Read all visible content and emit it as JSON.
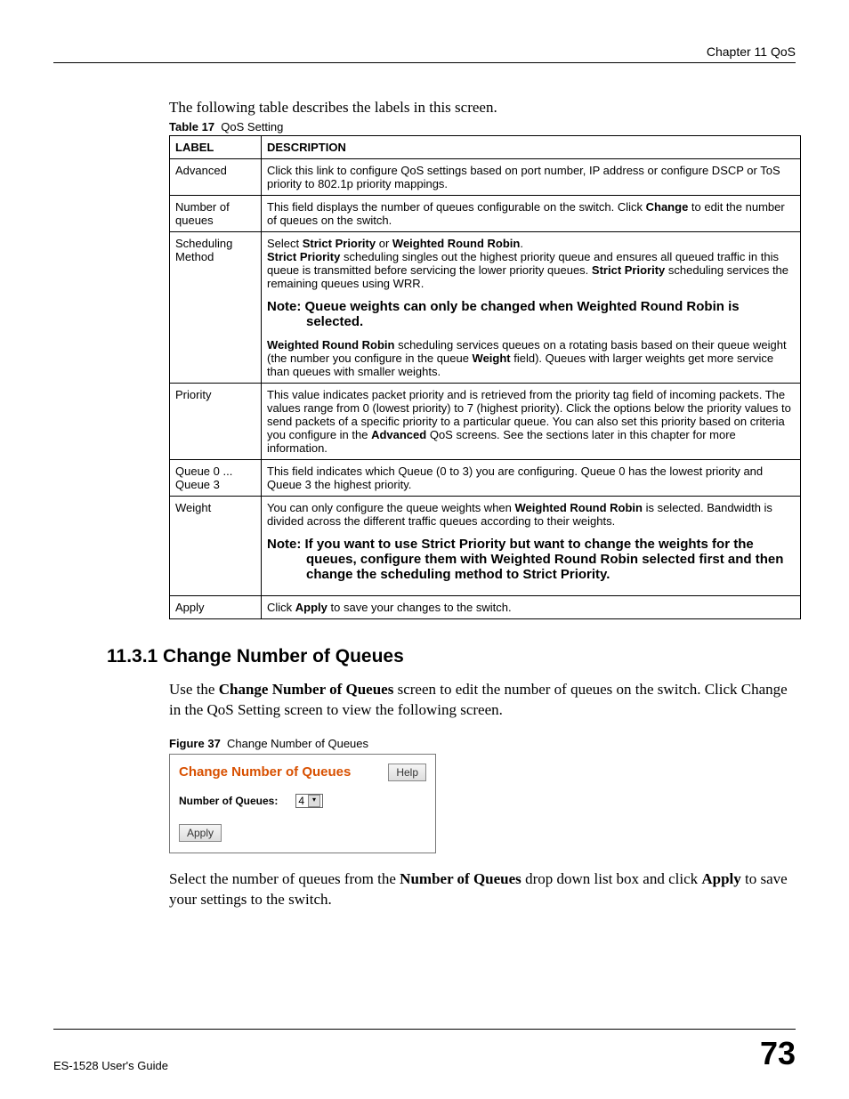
{
  "header": {
    "chapter": "Chapter 11 QoS"
  },
  "intro": "The following table describes the labels in this screen.",
  "table_caption": {
    "prefix": "Table 17",
    "title": "QoS Setting"
  },
  "columns": {
    "label": "LABEL",
    "description": "DESCRIPTION"
  },
  "rows": {
    "advanced": {
      "label": "Advanced",
      "desc": "Click this link to configure QoS settings based on port number, IP address or configure DSCP or ToS priority to 802.1p priority mappings."
    },
    "num_queues": {
      "label": "Number of queues",
      "desc_a": "This field displays the number of queues configurable on the switch. Click ",
      "change": "Change",
      "desc_b": " to edit the number of queues on the switch."
    },
    "sched": {
      "label": "Scheduling Method",
      "line1_a": "Select ",
      "strict": "Strict Priority",
      "or": " or ",
      "wrr": "Weighted Round Robin",
      "line1_b": ".",
      "line2_a": " scheduling singles out the highest priority queue and ensures all queued traffic in this queue is transmitted before servicing the lower priority queues. ",
      "line2_b": " scheduling services the remaining queues using WRR.",
      "note": "Note: Queue weights can only be changed when Weighted Round Robin is selected.",
      "line3_a": " scheduling services queues on a rotating basis based on their queue weight (the number you configure in the queue ",
      "weight": "Weight",
      "line3_b": " field). Queues with larger weights get more service than queues with smaller weights."
    },
    "priority": {
      "label": "Priority",
      "desc_a": "This value indicates packet priority and is retrieved from the priority tag field of incoming packets. The values range from 0 (lowest priority) to 7 (highest priority). Click the options below the priority values to send packets of a specific priority to a particular queue. You can also set this priority based on criteria you configure in the ",
      "advanced": "Advanced",
      "desc_b": " QoS screens. See the sections later in this chapter for more information."
    },
    "queue": {
      "label": "Queue 0 ... Queue 3",
      "desc": "This field indicates which Queue (0 to 3) you are configuring. Queue 0 has the lowest priority and Queue 3 the highest priority."
    },
    "weight": {
      "label": "Weight",
      "desc_a": "You can only configure the queue weights when ",
      "wrr": "Weighted Round Robin",
      "desc_b": " is selected. Bandwidth is divided across the different traffic queues according to their weights.",
      "note": "Note: If you want to use Strict Priority but want to change the weights for the queues, configure them with Weighted Round Robin selected first and then change the scheduling method to Strict Priority."
    },
    "apply": {
      "label": "Apply",
      "desc_a": "Click ",
      "apply": "Apply",
      "desc_b": " to save your changes to the switch."
    }
  },
  "section": {
    "heading": "11.3.1  Change Number of Queues",
    "para1_a": "Use the ",
    "para1_bold": "Change Number of Queues",
    "para1_b": " screen to edit the number of queues on the switch. Click Change in the QoS Setting screen to view the following screen.",
    "figure_caption_prefix": "Figure 37",
    "figure_caption_title": "Change Number of Queues",
    "screenshot": {
      "title": "Change Number of Queues",
      "help": "Help",
      "field_label": "Number of Queues:",
      "selected": "4",
      "apply": "Apply"
    },
    "para2_a": "Select the number of queues from the ",
    "para2_bold1": "Number of Queues",
    "para2_b": " drop down list box and click ",
    "para2_bold2": "Apply",
    "para2_c": " to save your settings to the switch."
  },
  "footer": {
    "guide": "ES-1528 User's Guide",
    "page": "73"
  }
}
